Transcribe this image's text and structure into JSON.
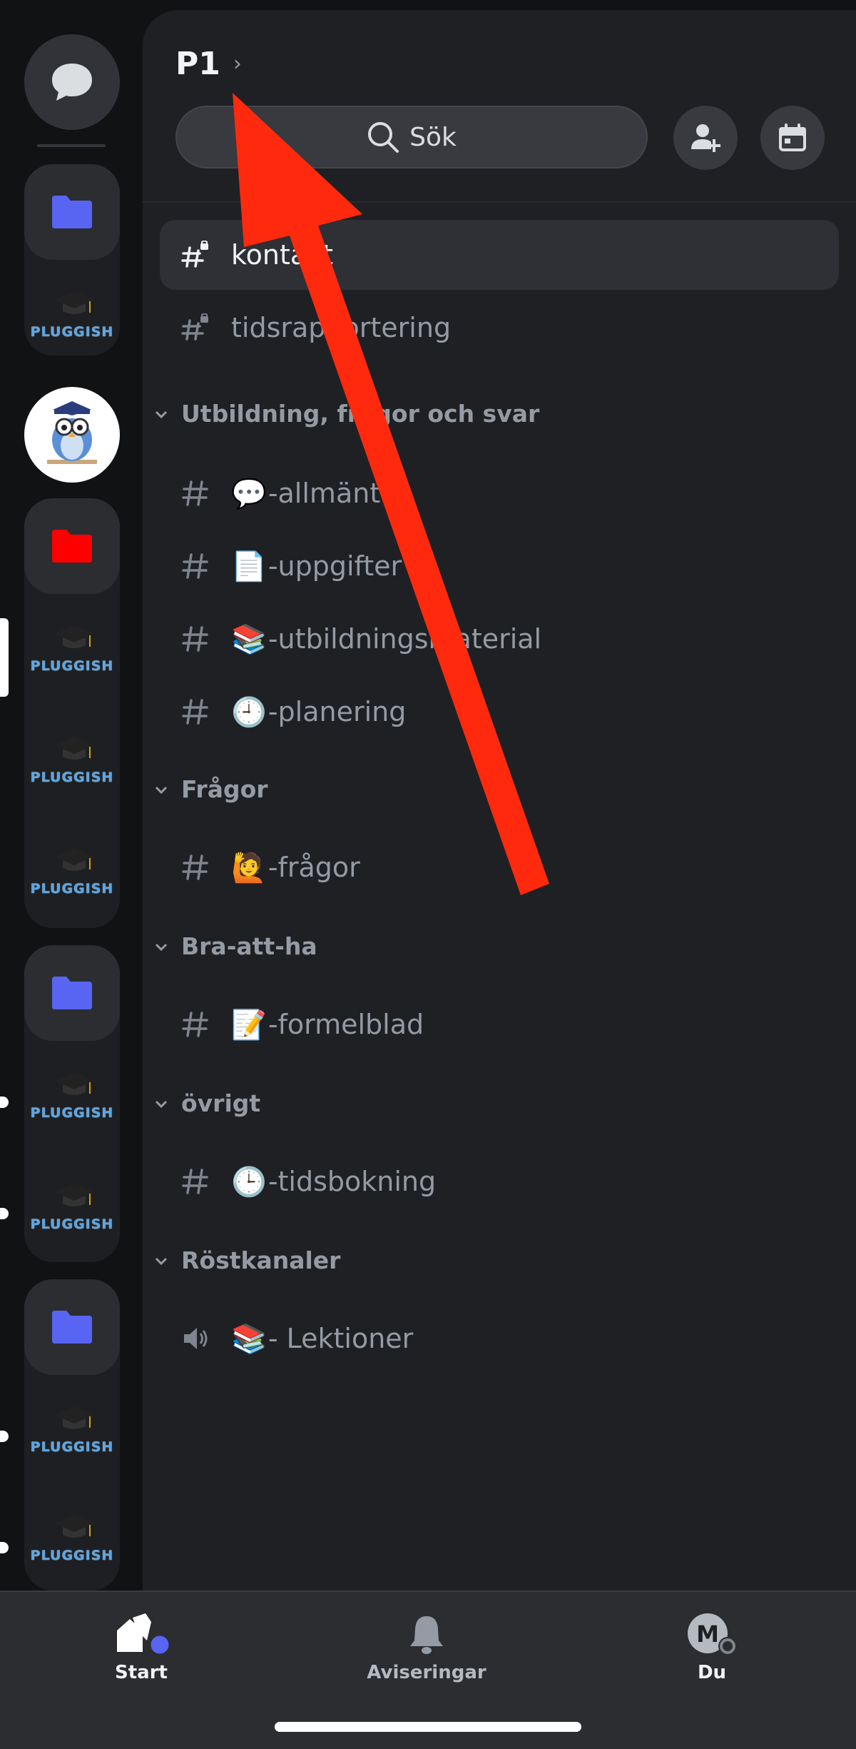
{
  "server": {
    "name": "P1",
    "chevron": "›"
  },
  "search": {
    "label": "Sök"
  },
  "rail": {
    "pluggish_word": "PLUGGISH"
  },
  "channels_top": [
    {
      "name": "kontakt",
      "icon": "hash-lock-icon",
      "active": true
    },
    {
      "name": "tidsrapportering",
      "icon": "hash-lock-icon",
      "active": false
    }
  ],
  "categories": [
    {
      "name": "Utbildning, frågor och svar",
      "channels": [
        {
          "emoji": "💬",
          "name": "-allmänt"
        },
        {
          "emoji": "📄",
          "name": "-uppgifter"
        },
        {
          "emoji": "📚",
          "name": "-utbildningsmaterial"
        },
        {
          "emoji": "🕘",
          "name": "-planering"
        }
      ]
    },
    {
      "name": "Frågor",
      "channels": [
        {
          "emoji": "🙋",
          "name": "-frågor"
        }
      ]
    },
    {
      "name": "Bra-att-ha",
      "channels": [
        {
          "emoji": "📝",
          "name": "-formelblad"
        }
      ]
    },
    {
      "name": "övrigt",
      "channels": [
        {
          "emoji": "🕒",
          "name": "-tidsbokning"
        }
      ]
    },
    {
      "name": "Röstkanaler",
      "channels": [
        {
          "emoji": "📚",
          "name": "- Lektioner",
          "voice": true
        }
      ]
    }
  ],
  "bottom_nav": {
    "start": "Start",
    "notifications": "Aviseringar",
    "you": "Du",
    "avatar_letter": "M"
  },
  "colors": {
    "accent": "#5865f2",
    "folder_red": "#ff0000",
    "annotation_arrow": "#ff2a0e"
  }
}
